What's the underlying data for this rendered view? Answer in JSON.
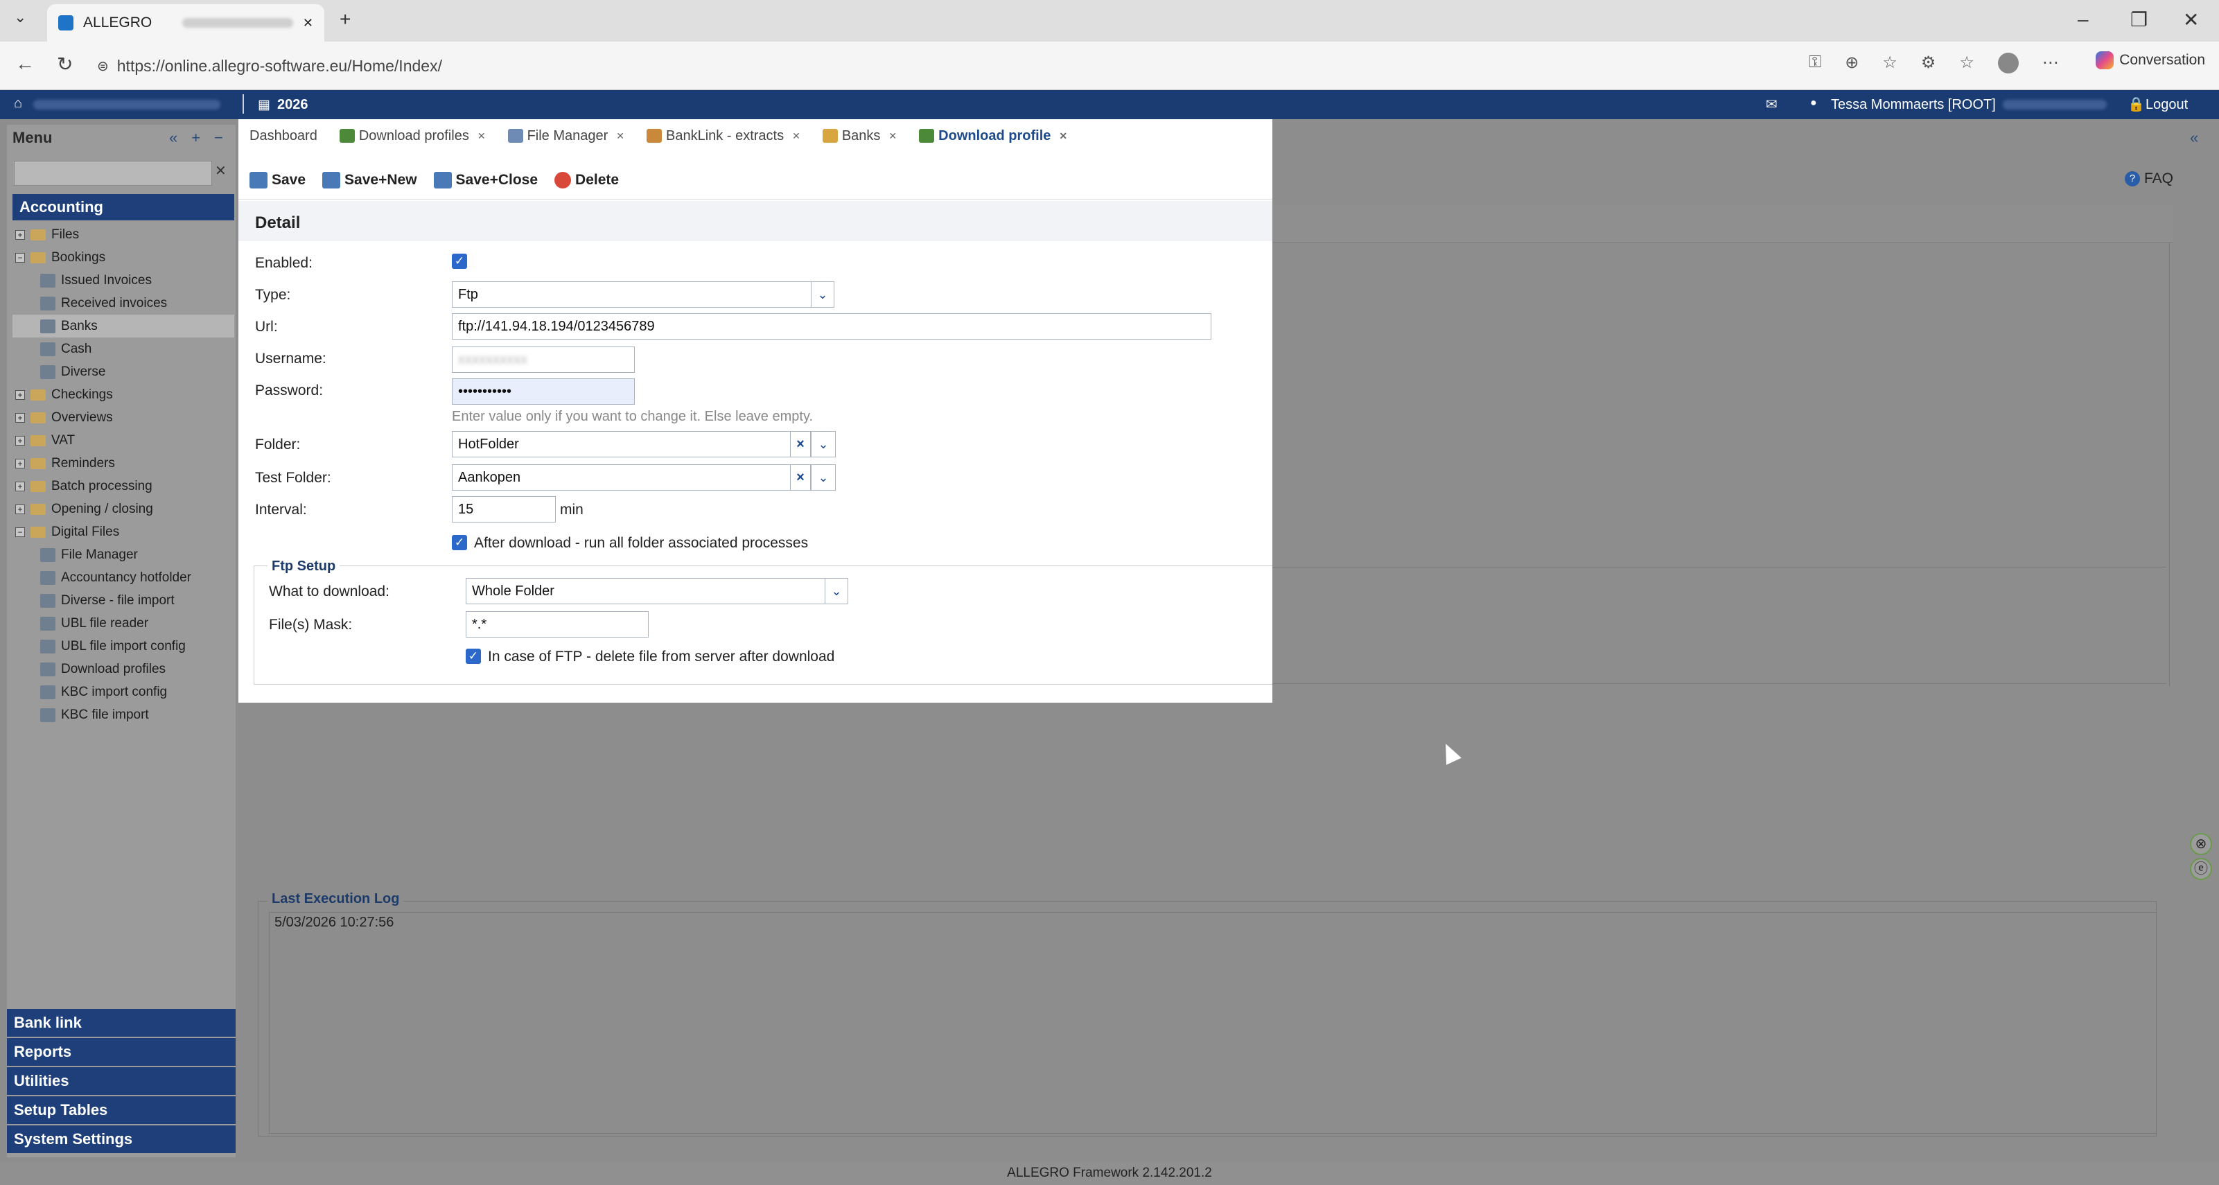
{
  "browser": {
    "tab_title": "ALLEGRO",
    "url": "https://online.allegro-software.eu/Home/Index/",
    "conversation_label": "Conversation",
    "new_tab": "+",
    "minimize": "–",
    "restore": "❐",
    "close": "✕"
  },
  "header": {
    "year": "2026",
    "user": "Tessa Mommaerts [ROOT]",
    "logout": "Logout"
  },
  "sidebar": {
    "title": "Menu",
    "section": "Accounting",
    "items": [
      {
        "label": "Files",
        "level": 0,
        "type": "folder",
        "expander": "+"
      },
      {
        "label": "Bookings",
        "level": 0,
        "type": "folder",
        "expander": "−"
      },
      {
        "label": "Issued Invoices",
        "level": 1,
        "type": "item"
      },
      {
        "label": "Received invoices",
        "level": 1,
        "type": "item"
      },
      {
        "label": "Banks",
        "level": 1,
        "type": "item",
        "selected": true
      },
      {
        "label": "Cash",
        "level": 1,
        "type": "item"
      },
      {
        "label": "Diverse",
        "level": 1,
        "type": "item"
      },
      {
        "label": "Checkings",
        "level": 0,
        "type": "folder",
        "expander": "+"
      },
      {
        "label": "Overviews",
        "level": 0,
        "type": "folder",
        "expander": "+"
      },
      {
        "label": "VAT",
        "level": 0,
        "type": "folder",
        "expander": "+"
      },
      {
        "label": "Reminders",
        "level": 0,
        "type": "folder",
        "expander": "+"
      },
      {
        "label": "Batch processing",
        "level": 0,
        "type": "folder",
        "expander": "+"
      },
      {
        "label": "Opening / closing",
        "level": 0,
        "type": "folder",
        "expander": "+"
      },
      {
        "label": "Digital Files",
        "level": 0,
        "type": "folder",
        "expander": "−"
      },
      {
        "label": "File Manager",
        "level": 1,
        "type": "item"
      },
      {
        "label": "Accountancy hotfolder",
        "level": 1,
        "type": "item"
      },
      {
        "label": "Diverse - file import",
        "level": 1,
        "type": "item"
      },
      {
        "label": "UBL file reader",
        "level": 1,
        "type": "item"
      },
      {
        "label": "UBL file import config",
        "level": 1,
        "type": "item"
      },
      {
        "label": "Download profiles",
        "level": 1,
        "type": "item"
      },
      {
        "label": "KBC import config",
        "level": 1,
        "type": "item"
      },
      {
        "label": "KBC file import",
        "level": 1,
        "type": "item"
      }
    ],
    "bottom": [
      "Bank link",
      "Reports",
      "Utilities",
      "Setup Tables",
      "System Settings"
    ]
  },
  "tabs": [
    {
      "label": "Dashboard",
      "closable": false,
      "icon_color": ""
    },
    {
      "label": "Download profiles",
      "closable": true,
      "icon_color": "#4c8a3a"
    },
    {
      "label": "File Manager",
      "closable": true,
      "icon_color": "#6d8bb5"
    },
    {
      "label": "BankLink - extracts",
      "closable": true,
      "icon_color": "#c9883a"
    },
    {
      "label": "Banks",
      "closable": true,
      "icon_color": "#d8a640"
    },
    {
      "label": "Download profile",
      "closable": true,
      "icon_color": "#4c8a3a",
      "active": true
    }
  ],
  "toolbar": {
    "save": "Save",
    "save_new": "Save+New",
    "save_close": "Save+Close",
    "delete": "Delete",
    "faq": "FAQ"
  },
  "detail": {
    "title": "Detail",
    "enabled_label": "Enabled:",
    "enabled": true,
    "type_label": "Type:",
    "type_value": "Ftp",
    "url_label": "Url:",
    "url_value": "ftp://141.94.18.194/0123456789",
    "username_label": "Username:",
    "password_label": "Password:",
    "password_value": "•••••••••••",
    "password_hint": "Enter value only if you want to change it. Else leave empty.",
    "folder_label": "Folder:",
    "folder_value": "HotFolder",
    "test_folder_label": "Test Folder:",
    "test_folder_value": "Aankopen",
    "interval_label": "Interval:",
    "interval_value": "15",
    "interval_unit": "min",
    "after_download_label": "After download - run all folder associated processes",
    "after_download": true
  },
  "ftp_setup": {
    "legend": "Ftp Setup",
    "what_label": "What to download:",
    "what_value": "Whole Folder",
    "mask_label": "File(s) Mask:",
    "mask_value": "*.*",
    "delete_label": "In case of FTP - delete file from server after download",
    "delete": true
  },
  "log": {
    "legend": "Last Execution Log",
    "entry": "5/03/2026 10:27:56"
  },
  "footer": "ALLEGRO Framework 2.142.201.2"
}
